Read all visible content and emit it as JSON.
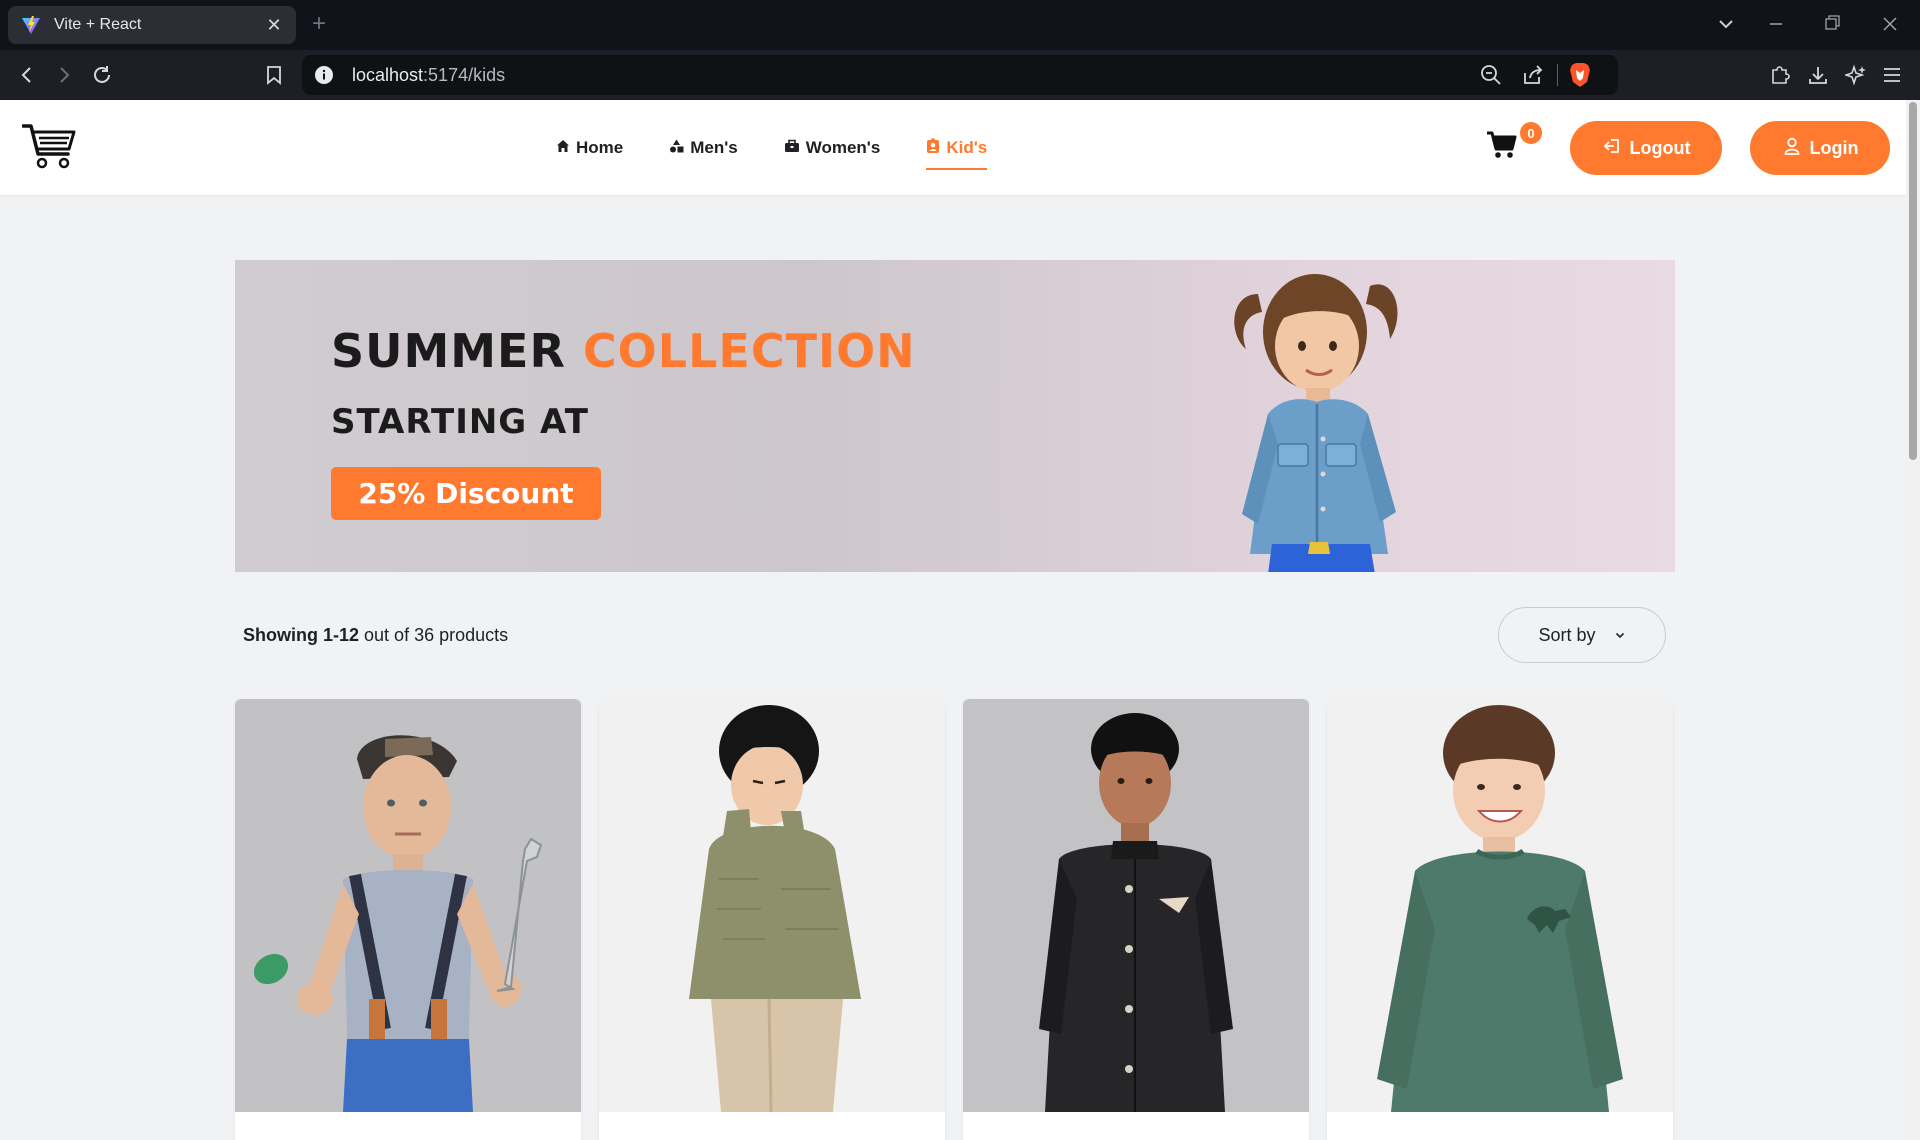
{
  "browser": {
    "tab_title": "Vite + React",
    "url_host": "localhost",
    "url_path": ":5174/kids"
  },
  "header": {
    "nav": [
      {
        "label": "Home",
        "icon": "home-icon"
      },
      {
        "label": "Men's",
        "icon": "shapes-icon"
      },
      {
        "label": "Women's",
        "icon": "briefcase-icon"
      },
      {
        "label": "Kid's",
        "icon": "kid-icon",
        "active": true
      }
    ],
    "cart_count": "0",
    "logout_label": "Logout",
    "login_label": "Login"
  },
  "banner": {
    "line1_word1": "SUMMER",
    "line1_word2": "COLLECTION",
    "line2": "STARTING AT",
    "discount": "25% Discount"
  },
  "listing": {
    "showing_range": "Showing 1-12",
    "showing_rest": "out of 36 products",
    "sort_label": "Sort by"
  },
  "products": [
    {
      "image": "boy-with-wrench-and-suspenders"
    },
    {
      "image": "boy-in-green-sweater"
    },
    {
      "image": "boy-in-black-nehru-jacket"
    },
    {
      "image": "boy-in-green-dinosaur-sweatshirt"
    }
  ],
  "colors": {
    "accent": "#ff7a2f",
    "chrome_dark": "#101319",
    "page_bg": "#f1f2f4"
  }
}
